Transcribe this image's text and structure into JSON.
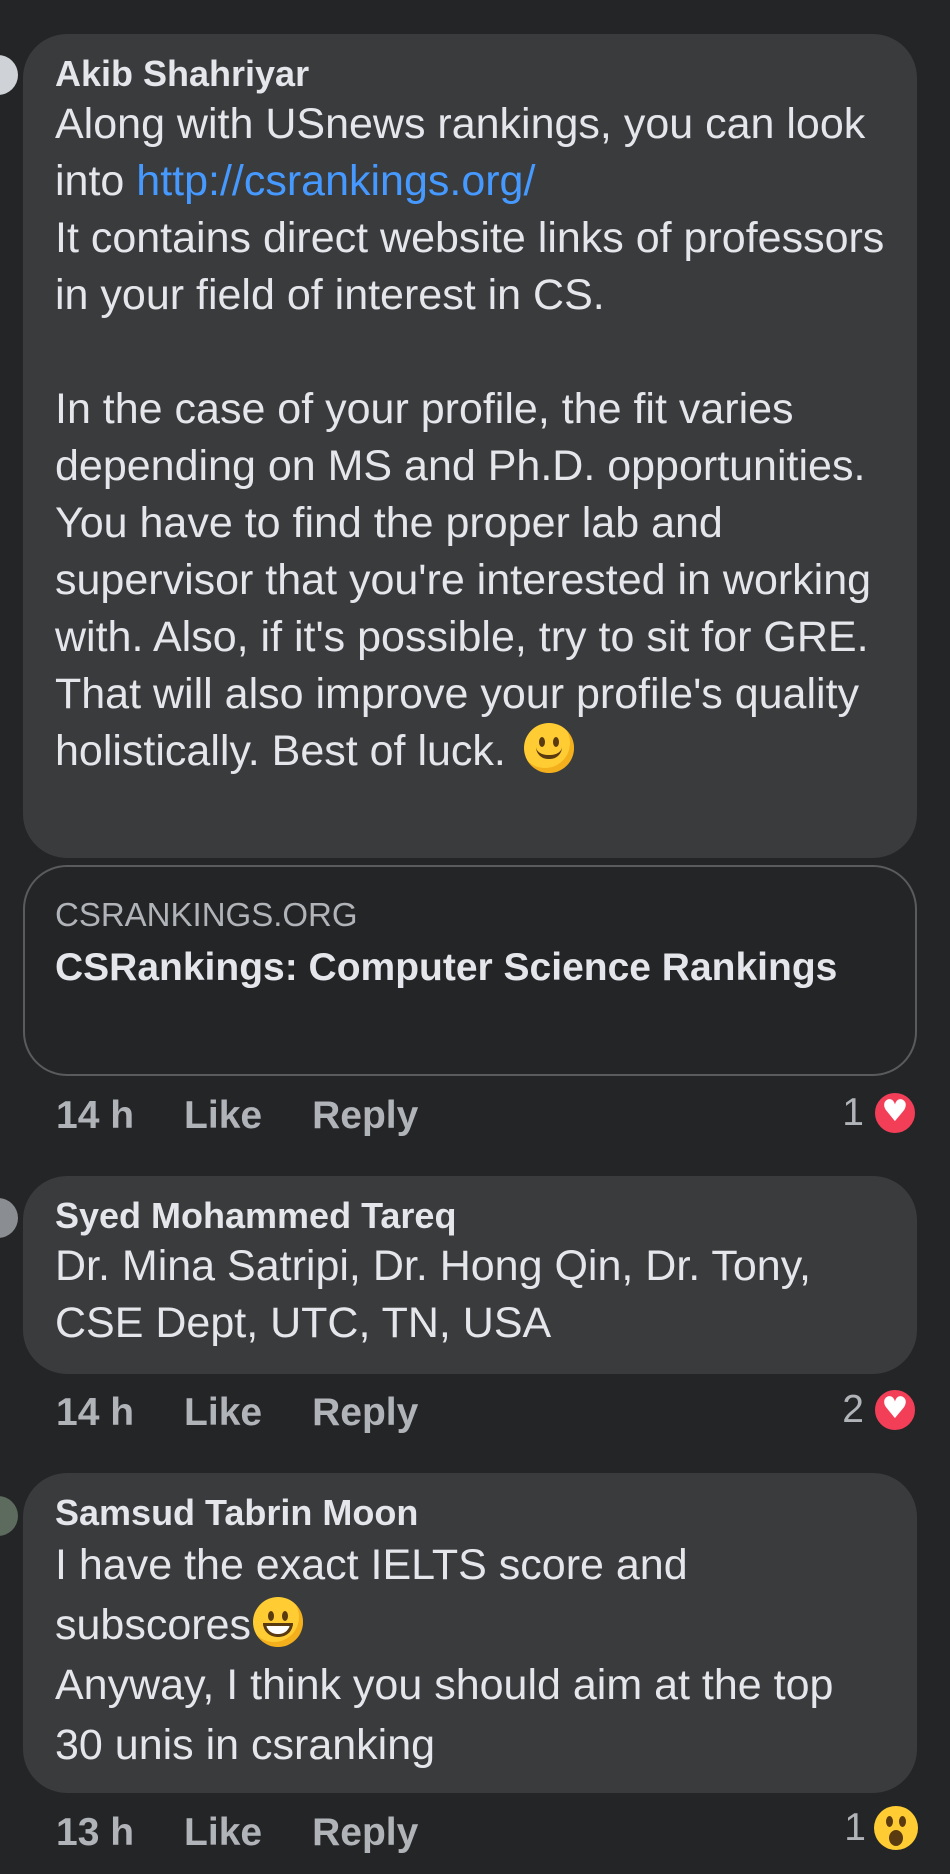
{
  "comments": [
    {
      "author": "Akib Shahriyar",
      "text_before_link": "Along with USnews rankings, you can look into ",
      "link": "http://csrankings.org/",
      "text_after_link": "\nIt contains direct website links of professors in your field of interest in CS.\n\nIn the case of your profile, the fit varies depending on MS and Ph.D. opportunities. You have to find the proper lab and supervisor that you're interested in working with. Also, if it's possible, try to sit for GRE. That will also improve your profile's quality holistically. Best of luck.",
      "emoji": "slightly-smiling-face",
      "link_preview": {
        "domain": "CSRANKINGS.ORG",
        "title": "CSRankings: Computer Science Rankings"
      },
      "time": "14 h",
      "like_label": "Like",
      "reply_label": "Reply",
      "reaction_count": "1",
      "reaction_icon": "love-reaction"
    },
    {
      "author": "Syed Mohammed Tareq",
      "text": "Dr. Mina Satripi, Dr. Hong Qin, Dr. Tony, CSE Dept, UTC, TN, USA",
      "time": "14 h",
      "like_label": "Like",
      "reply_label": "Reply",
      "reaction_count": "2",
      "reaction_icon": "love-reaction"
    },
    {
      "author": "Samsud Tabrin Moon",
      "text_line1": "I have the exact IELTS score and subscores",
      "emoji": "grinning-face",
      "text_line2": "Anyway, I think you should aim at the top 30 unis in csranking",
      "time": "13 h",
      "like_label": "Like",
      "reply_label": "Reply",
      "reaction_count": "1",
      "reaction_icon": "wow-reaction"
    }
  ],
  "colors": {
    "background": "#242526",
    "bubble": "#3a3b3c",
    "link": "#4599ff",
    "love": "#f33e58",
    "muted_text": "#b0b3b8"
  }
}
